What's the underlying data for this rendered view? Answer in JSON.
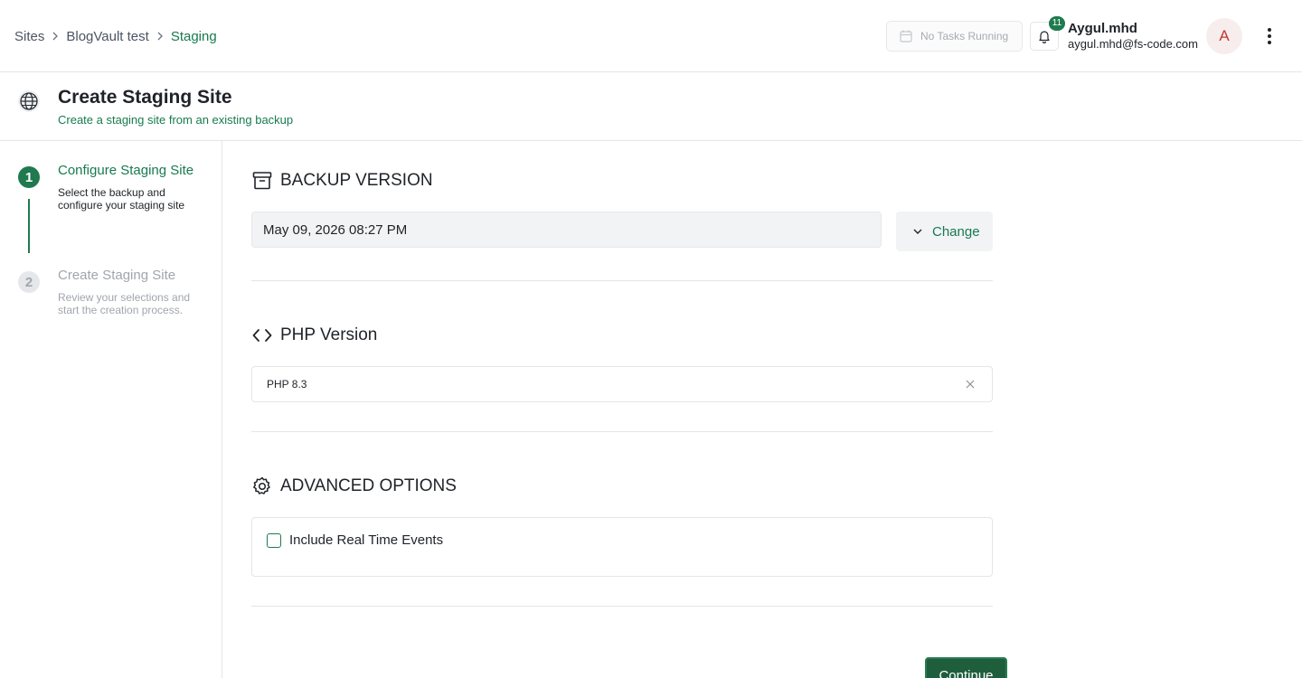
{
  "breadcrumb": {
    "items": [
      "Sites",
      "BlogVault test",
      "Staging"
    ]
  },
  "header": {
    "tasks_label": "No Tasks Running",
    "notification_count": "11",
    "user_name": "Aygul.mhd",
    "user_email": "aygul.mhd@fs-code.com",
    "avatar_initial": "A"
  },
  "page": {
    "title": "Create Staging Site",
    "subtitle": "Create a staging site from an existing backup",
    "icon": "globe-icon"
  },
  "stepper": {
    "steps": [
      {
        "number": "1",
        "title": "Configure Staging Site",
        "description": "Select the backup and configure your staging site",
        "state": "active"
      },
      {
        "number": "2",
        "title": "Create Staging Site",
        "description": "Review your selections and start the creation process.",
        "state": "inactive"
      }
    ]
  },
  "backup": {
    "section_title": "BACKUP VERSION",
    "icon": "archive-icon",
    "selected_value": "May 09, 2026 08:27 PM",
    "change_label": "Change"
  },
  "php": {
    "section_title": "PHP Version",
    "icon": "code-icon",
    "selected_value": "PHP 8.3"
  },
  "advanced": {
    "section_title": "ADVANCED OPTIONS",
    "icon": "gear-icon",
    "checkbox_label": "Include Real Time Events",
    "checked": false
  },
  "actions": {
    "continue_label": "Continue"
  },
  "colors": {
    "brand_green": "#177a4f",
    "button_green": "#1f5e3d",
    "border": "#e3e5e8"
  }
}
